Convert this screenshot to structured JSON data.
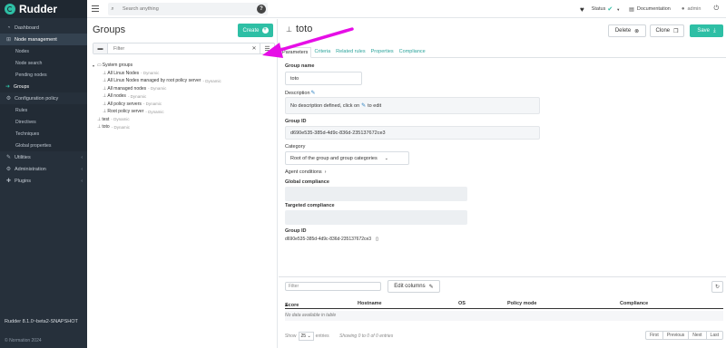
{
  "app": {
    "name": "Rudder",
    "version": "Rudder 8.1.0~beta2-SNAPSHOT",
    "copyright": "© Normation 2024"
  },
  "sidebar": {
    "items": [
      {
        "label": "Dashboard",
        "icon": "dashboard-icon"
      },
      {
        "label": "Node management",
        "icon": "sitemap-icon"
      },
      {
        "label": "Nodes"
      },
      {
        "label": "Node search"
      },
      {
        "label": "Pending nodes"
      },
      {
        "label": "Groups"
      },
      {
        "label": "Configuration policy",
        "icon": "gear-icon"
      },
      {
        "label": "Rules"
      },
      {
        "label": "Directives"
      },
      {
        "label": "Techniques"
      },
      {
        "label": "Global properties"
      },
      {
        "label": "Utilities",
        "icon": "wrench-icon"
      },
      {
        "label": "Administration",
        "icon": "gears-icon"
      },
      {
        "label": "Plugins",
        "icon": "puzzle-icon"
      }
    ]
  },
  "topbar": {
    "search_placeholder": "Search anything",
    "help": "?",
    "status": "Status",
    "documentation": "Documentation",
    "user": "admin"
  },
  "groups": {
    "title": "Groups",
    "create_label": "Create",
    "filter_placeholder": "Filter",
    "tree": [
      {
        "label": "System groups",
        "tag": ""
      },
      {
        "label": "All Linux Nodes",
        "tag": "- Dynamic"
      },
      {
        "label": "All Linux Nodes managed by root policy server",
        "tag": "- Dynamic"
      },
      {
        "label": "All managed nodes",
        "tag": "- Dynamic"
      },
      {
        "label": "All nodes",
        "tag": "- Dynamic"
      },
      {
        "label": "All policy servers",
        "tag": "- Dynamic"
      },
      {
        "label": "Root policy server",
        "tag": "- Dynamic"
      },
      {
        "label": "test",
        "tag": "- Dynamic"
      },
      {
        "label": "toto",
        "tag": "- Dynamic"
      }
    ]
  },
  "detail": {
    "title": "toto",
    "delete_label": "Delete",
    "clone_label": "Clone",
    "save_label": "Save",
    "tabs": [
      "Parameters",
      "Criteria",
      "Related rules",
      "Properties",
      "Compliance"
    ],
    "group_name_label": "Group name",
    "group_name_value": "toto",
    "description_label": "Description",
    "description_value": "No description defined, click on",
    "description_suffix": "to edit",
    "group_id_label": "Group ID",
    "group_id_value": "d690e535-385d-4d9c-836d-235137672ce3",
    "category_label": "Category",
    "category_value": "Root of the group and group categories",
    "agent_conditions_label": "Agent conditions",
    "global_compliance_label": "Global compliance",
    "targeted_compliance_label": "Targeted compliance",
    "group_id_label2": "Group ID",
    "group_id_text": "d690e535-385d-4d9c-836d-235137672ce3"
  },
  "table": {
    "filter_placeholder": "Filter",
    "edit_columns_label": "Edit columns",
    "columns": [
      "Score",
      "Hostname",
      "OS",
      "Policy mode",
      "Compliance"
    ],
    "empty_text": "No data available in table",
    "show_label": "Show",
    "page_size": "25",
    "entries_label": "entries",
    "showing_text": "Showing 0 to 0 of 0 entries",
    "pager": [
      "First",
      "Previous",
      "Next",
      "Last"
    ]
  },
  "colors": {
    "accent": "#2ebfa5",
    "sidebar_bg": "#26303b",
    "annotation": "#e60ee6"
  }
}
